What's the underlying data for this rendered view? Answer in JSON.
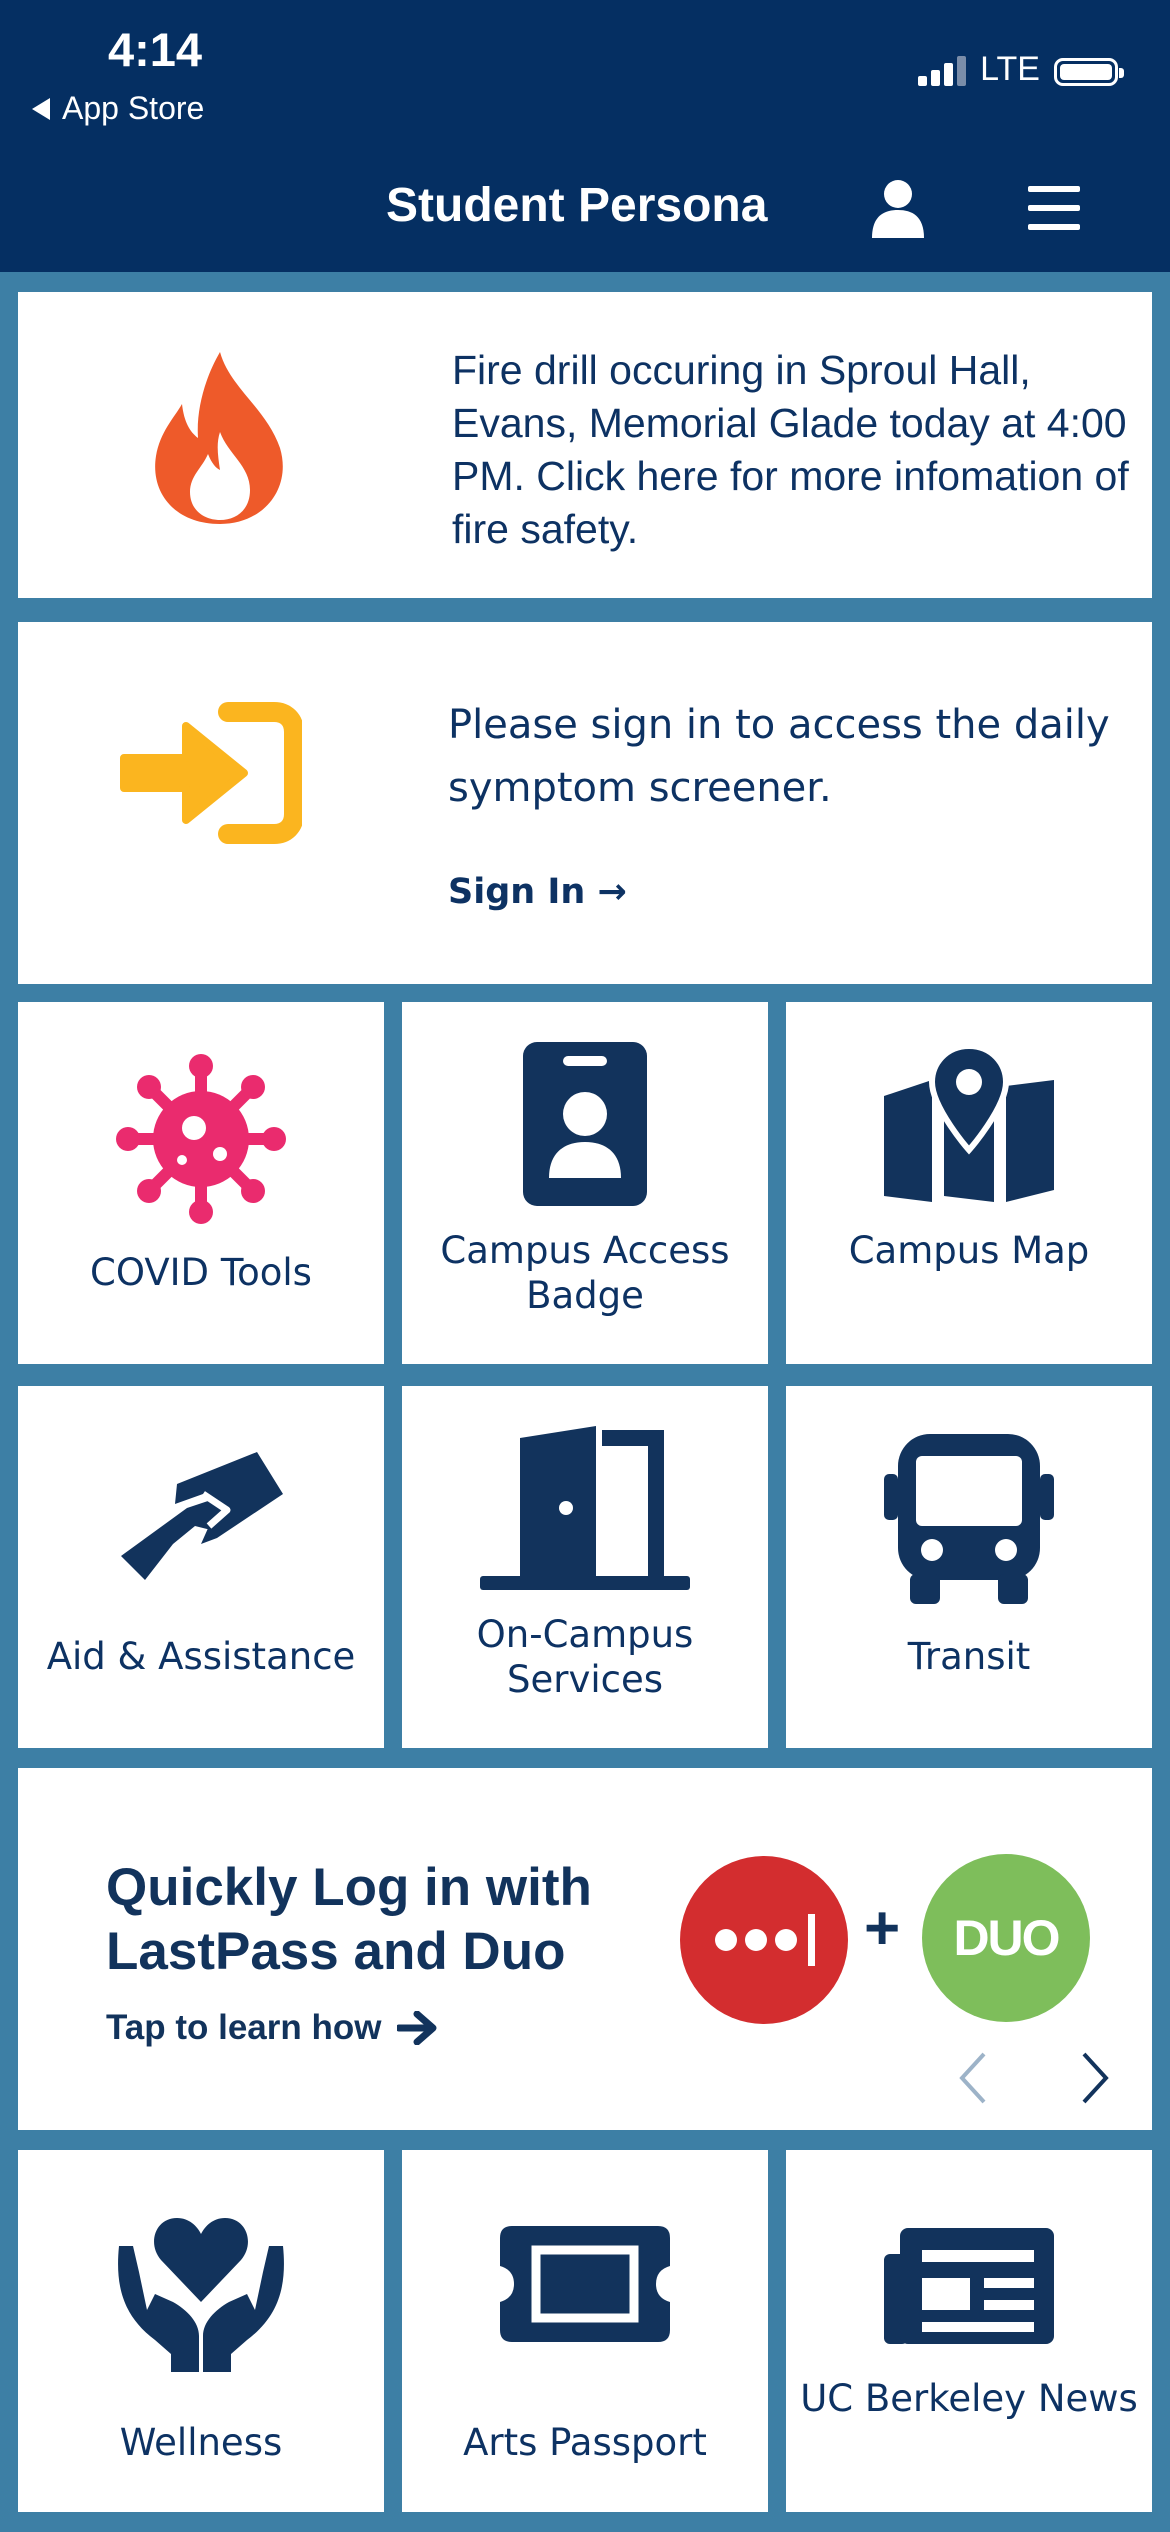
{
  "status_bar": {
    "time": "4:14",
    "back_label": "App Store",
    "network": "LTE"
  },
  "header": {
    "title": "Student Persona",
    "profile_icon": "user-icon",
    "menu_icon": "hamburger-menu-icon",
    "background_color": "#052f62"
  },
  "alert": {
    "icon": "fire-icon",
    "text": "Fire drill occuring in Sproul Hall, Evans, Memorial Glade today at 4:00 PM. Click here for more infomation of fire safety.",
    "icon_color": "#ee5a2a"
  },
  "sign_in_card": {
    "icon": "sign-in-arrow-icon",
    "text": "Please sign in to access the daily symptom screener.",
    "link": "Sign In →",
    "icon_color": "#fbb51f"
  },
  "tiles_row1": [
    {
      "label": "COVID Tools",
      "icon": "virus-icon"
    },
    {
      "label": "Campus Access Badge",
      "icon": "id-badge-icon"
    },
    {
      "label": "Campus Map",
      "icon": "map-pin-icon"
    }
  ],
  "tiles_row2": [
    {
      "label": "Aid & Assistance",
      "icon": "handshake-icon"
    },
    {
      "label": "On-Campus Services",
      "icon": "door-icon"
    },
    {
      "label": "Transit",
      "icon": "bus-icon"
    }
  ],
  "promo": {
    "title": "Quickly Log in with LastPass and Duo",
    "subtitle": "Tap to learn how",
    "plus": "+",
    "duo_logo_text": "DUO",
    "lastpass_color": "#d32d2f",
    "duo_color": "#7ebe5b"
  },
  "tiles_row3": [
    {
      "label": "Wellness",
      "icon": "heart-hands-icon"
    },
    {
      "label": "Arts Passport",
      "icon": "ticket-icon"
    },
    {
      "label": "UC Berkeley News",
      "icon": "newspaper-icon"
    }
  ],
  "colors": {
    "accent": "#0d3263",
    "page_background": "#3d7fa5",
    "covid_icon": "#ea2b6e"
  }
}
